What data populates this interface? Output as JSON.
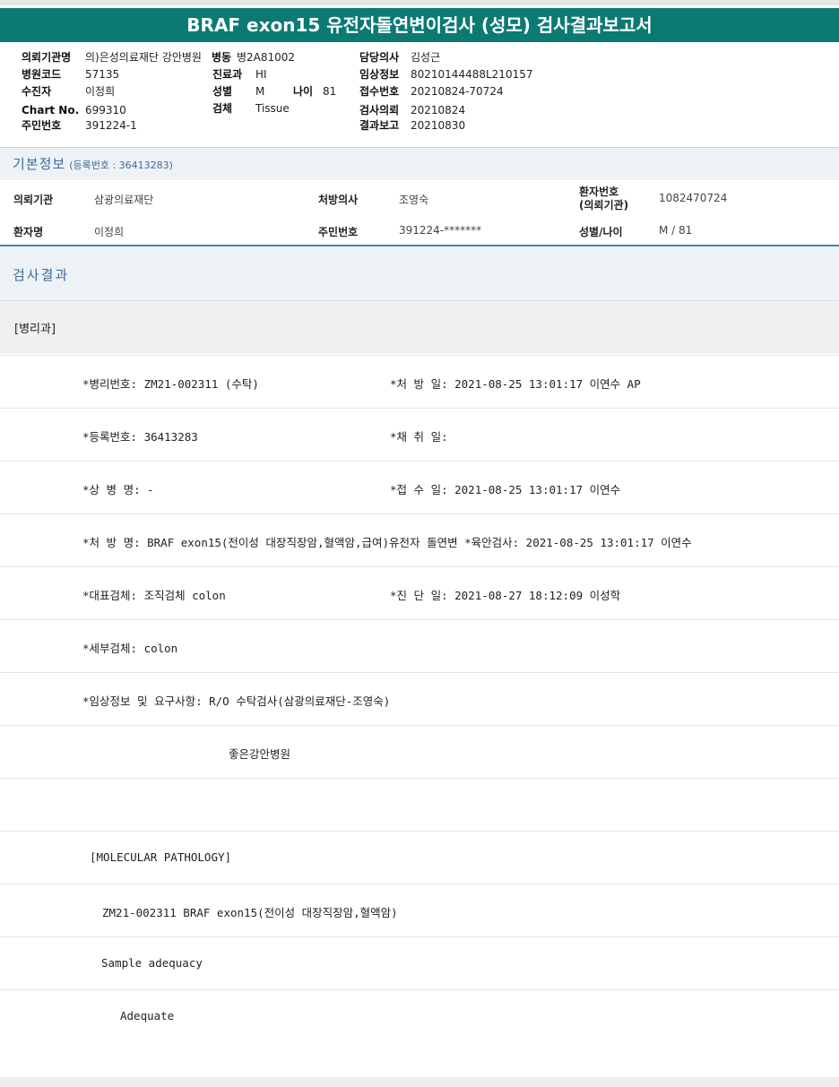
{
  "title": "BRAF exon15 유전자돌연변이검사 (성모) 검사결과보고서",
  "header": {
    "req_org_label": "의뢰기관명",
    "req_org_value": "의)은성의료재단 강안병원",
    "ward_label": "병동",
    "ward_value": "병2A81002",
    "doctor_label": "담당의사",
    "doctor_value": "김성근",
    "hosp_code_label": "병원코드",
    "hosp_code_value": "57135",
    "dept_label": "진료과",
    "dept_value": "HI",
    "clinical_label": "임상정보",
    "clinical_value": "80210144488L210157",
    "patient_label": "수진자",
    "patient_value": "이정희",
    "sex_label": "성별",
    "sex_value": "M",
    "age_label": "나이",
    "age_value": "81",
    "receipt_label": "접수번호",
    "receipt_value": "20210824-70724",
    "chart_label": "Chart No.",
    "chart_value": "699310",
    "specimen_label": "검체",
    "specimen_value": "Tissue",
    "test_req_label": "검사의뢰",
    "test_req_value": "20210824",
    "rrn_label": "주민번호",
    "rrn_value": "391224-1",
    "report_label": "결과보고",
    "report_value": "20210830"
  },
  "basic": {
    "title": "기본정보",
    "reg_no": "(등록번호 : 36413283)",
    "org_label": "의뢰기관",
    "org_value": "삼광의료재단",
    "presc_label": "처방의사",
    "presc_value": "조영숙",
    "pt_no_label1": "환자번호",
    "pt_no_label2": "(의뢰기관)",
    "pt_no_value": "1082470724",
    "name_label": "환자명",
    "name_value": "이정희",
    "rrn_label": "주민번호",
    "rrn_value": "391224-*******",
    "sexage_label": "성별/나이",
    "sexage_value": "M / 81"
  },
  "results": {
    "title": "검사결과",
    "dept": "[병리과]",
    "rows": [
      {
        "left": "*병리번호: ZM21-002311 (수탁)",
        "right": "*처 방 일: 2021-08-25 13:01:17  이연수 AP"
      },
      {
        "left": "*등록번호: 36413283",
        "right": "*채 취 일:"
      },
      {
        "left": "*상 병 명: -",
        "right": "*접 수 일: 2021-08-25 13:01:17  이연수"
      },
      {
        "left": "*처 방 명: BRAF exon15(전이성 대장직장암,혈액암,급여)유전자 돌연변  *육안검사: 2021-08-25 13:01:17  이연수",
        "right": ""
      },
      {
        "left": "*대표검체: 조직검체 colon",
        "right": "*진 단 일: 2021-08-27 18:12:09  이성학"
      },
      {
        "left": "*세부검체: colon",
        "right": ""
      },
      {
        "left": "*임상정보 및 요구사항: R/O 수탁검사(삼광의료재단-조영숙)",
        "right": ""
      },
      {
        "left": "좋은강안병원",
        "right": ""
      },
      {
        "left": "",
        "right": ""
      },
      {
        "left": "[MOLECULAR PATHOLOGY]",
        "right": ""
      },
      {
        "left": "ZM21-002311     BRAF exon15(전이성 대장직장암,혈액암)",
        "right": ""
      },
      {
        "left": "Sample adequacy",
        "right": ""
      },
      {
        "left": "Adequate",
        "right": ""
      }
    ]
  }
}
